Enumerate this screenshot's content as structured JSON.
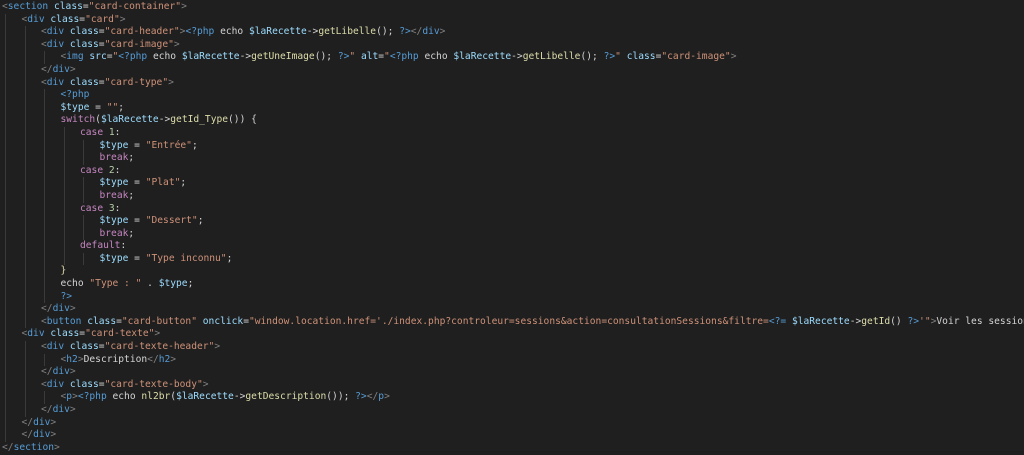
{
  "colors": {
    "background": "#1f1f1f",
    "punctuation": "#808080",
    "tag": "#569cd6",
    "attribute": "#9cdcfe",
    "string": "#ce9178",
    "variable": "#9cdcfe",
    "function": "#dcdcaa",
    "keyword": "#c586c0",
    "number": "#b5cea8",
    "text": "#d4d4d4",
    "phpTag": "#569cd6"
  },
  "lines": [
    {
      "indent": 0,
      "tokens": [
        [
          "p",
          "<"
        ],
        [
          "tag",
          "section"
        ],
        [
          "text",
          " "
        ],
        [
          "attribute",
          "class"
        ],
        [
          "text",
          "="
        ],
        [
          "string",
          "\"card-container\""
        ],
        [
          "p",
          ">"
        ]
      ]
    },
    {
      "indent": 1,
      "tokens": [
        [
          "p",
          "<"
        ],
        [
          "tag",
          "div"
        ],
        [
          "text",
          " "
        ],
        [
          "attribute",
          "class"
        ],
        [
          "text",
          "="
        ],
        [
          "string",
          "\"card\""
        ],
        [
          "p",
          ">"
        ]
      ]
    },
    {
      "indent": 2,
      "tokens": [
        [
          "p",
          "<"
        ],
        [
          "tag",
          "div"
        ],
        [
          "text",
          " "
        ],
        [
          "attribute",
          "class"
        ],
        [
          "text",
          "="
        ],
        [
          "string",
          "\"card-header\""
        ],
        [
          "p",
          ">"
        ],
        [
          "phpTag",
          "<?php"
        ],
        [
          "text",
          " echo "
        ],
        [
          "variable",
          "$laRecette"
        ],
        [
          "text",
          "->"
        ],
        [
          "function",
          "getLibelle"
        ],
        [
          "text",
          "(); "
        ],
        [
          "phpTag",
          "?>"
        ],
        [
          "p",
          "</"
        ],
        [
          "tag",
          "div"
        ],
        [
          "p",
          ">"
        ]
      ]
    },
    {
      "indent": 2,
      "tokens": [
        [
          "p",
          "<"
        ],
        [
          "tag",
          "div"
        ],
        [
          "text",
          " "
        ],
        [
          "attribute",
          "class"
        ],
        [
          "text",
          "="
        ],
        [
          "string",
          "\"card-image\""
        ],
        [
          "p",
          ">"
        ]
      ]
    },
    {
      "indent": 3,
      "tokens": [
        [
          "p",
          "<"
        ],
        [
          "tag",
          "img"
        ],
        [
          "text",
          " "
        ],
        [
          "attribute",
          "src"
        ],
        [
          "text",
          "="
        ],
        [
          "string",
          "\""
        ],
        [
          "phpTag",
          "<?php"
        ],
        [
          "text",
          " echo "
        ],
        [
          "variable",
          "$laRecette"
        ],
        [
          "text",
          "->"
        ],
        [
          "function",
          "getUneImage"
        ],
        [
          "text",
          "(); "
        ],
        [
          "phpTag",
          "?>"
        ],
        [
          "string",
          "\""
        ],
        [
          "text",
          " "
        ],
        [
          "attribute",
          "alt"
        ],
        [
          "text",
          "="
        ],
        [
          "string",
          "\""
        ],
        [
          "phpTag",
          "<?php"
        ],
        [
          "text",
          " echo "
        ],
        [
          "variable",
          "$laRecette"
        ],
        [
          "text",
          "->"
        ],
        [
          "function",
          "getLibelle"
        ],
        [
          "text",
          "(); "
        ],
        [
          "phpTag",
          "?>"
        ],
        [
          "string",
          "\""
        ],
        [
          "text",
          " "
        ],
        [
          "attribute",
          "class"
        ],
        [
          "text",
          "="
        ],
        [
          "string",
          "\"card-image\""
        ],
        [
          "p",
          ">"
        ]
      ]
    },
    {
      "indent": 2,
      "tokens": [
        [
          "p",
          "</"
        ],
        [
          "tag",
          "div"
        ],
        [
          "p",
          ">"
        ]
      ]
    },
    {
      "indent": 2,
      "tokens": [
        [
          "p",
          "<"
        ],
        [
          "tag",
          "div"
        ],
        [
          "text",
          " "
        ],
        [
          "attribute",
          "class"
        ],
        [
          "text",
          "="
        ],
        [
          "string",
          "\"card-type\""
        ],
        [
          "p",
          ">"
        ]
      ]
    },
    {
      "indent": 3,
      "tokens": [
        [
          "phpTag",
          "<?php"
        ]
      ]
    },
    {
      "indent": 3,
      "tokens": [
        [
          "variable",
          "$type"
        ],
        [
          "text",
          " = "
        ],
        [
          "string",
          "\"\""
        ],
        [
          "text",
          ";"
        ]
      ]
    },
    {
      "indent": 3,
      "tokens": [
        [
          "keyword",
          "switch"
        ],
        [
          "text",
          "("
        ],
        [
          "variable",
          "$laRecette"
        ],
        [
          "text",
          "->"
        ],
        [
          "function",
          "getId_Type"
        ],
        [
          "text",
          "()) {"
        ]
      ]
    },
    {
      "indent": 4,
      "tokens": [
        [
          "keyword",
          "case"
        ],
        [
          "text",
          " "
        ],
        [
          "number",
          "1"
        ],
        [
          "text",
          ":"
        ]
      ]
    },
    {
      "indent": 5,
      "tokens": [
        [
          "variable",
          "$type"
        ],
        [
          "text",
          " = "
        ],
        [
          "string",
          "\"Entrée\""
        ],
        [
          "text",
          ";"
        ]
      ]
    },
    {
      "indent": 5,
      "tokens": [
        [
          "keyword",
          "break"
        ],
        [
          "text",
          ";"
        ]
      ]
    },
    {
      "indent": 4,
      "tokens": [
        [
          "keyword",
          "case"
        ],
        [
          "text",
          " "
        ],
        [
          "number",
          "2"
        ],
        [
          "text",
          ":"
        ]
      ]
    },
    {
      "indent": 5,
      "tokens": [
        [
          "variable",
          "$type"
        ],
        [
          "text",
          " = "
        ],
        [
          "string",
          "\"Plat\""
        ],
        [
          "text",
          ";"
        ]
      ]
    },
    {
      "indent": 5,
      "tokens": [
        [
          "keyword",
          "break"
        ],
        [
          "text",
          ";"
        ]
      ]
    },
    {
      "indent": 4,
      "tokens": [
        [
          "keyword",
          "case"
        ],
        [
          "text",
          " "
        ],
        [
          "number",
          "3"
        ],
        [
          "text",
          ":"
        ]
      ]
    },
    {
      "indent": 5,
      "tokens": [
        [
          "variable",
          "$type"
        ],
        [
          "text",
          " = "
        ],
        [
          "string",
          "\"Dessert\""
        ],
        [
          "text",
          ";"
        ]
      ]
    },
    {
      "indent": 5,
      "tokens": [
        [
          "keyword",
          "break"
        ],
        [
          "text",
          ";"
        ]
      ]
    },
    {
      "indent": 4,
      "tokens": [
        [
          "keyword",
          "default"
        ],
        [
          "text",
          ":"
        ]
      ]
    },
    {
      "indent": 5,
      "tokens": [
        [
          "variable",
          "$type"
        ],
        [
          "text",
          " = "
        ],
        [
          "string",
          "\"Type inconnu\""
        ],
        [
          "text",
          ";"
        ]
      ]
    },
    {
      "indent": 3,
      "tokens": [
        [
          "function",
          "}"
        ]
      ]
    },
    {
      "indent": 3,
      "tokens": [
        [
          "text",
          "echo "
        ],
        [
          "string",
          "\"Type : \""
        ],
        [
          "text",
          " . "
        ],
        [
          "variable",
          "$type"
        ],
        [
          "text",
          ";"
        ]
      ]
    },
    {
      "indent": 3,
      "tokens": [
        [
          "phpTag",
          "?>"
        ]
      ]
    },
    {
      "indent": 2,
      "tokens": [
        [
          "p",
          "</"
        ],
        [
          "tag",
          "div"
        ],
        [
          "p",
          ">"
        ]
      ]
    },
    {
      "indent": 2,
      "tokens": [
        [
          "p",
          "<"
        ],
        [
          "tag",
          "button"
        ],
        [
          "text",
          " "
        ],
        [
          "attribute",
          "class"
        ],
        [
          "text",
          "="
        ],
        [
          "string",
          "\"card-button\""
        ],
        [
          "text",
          " "
        ],
        [
          "attribute",
          "onclick"
        ],
        [
          "text",
          "="
        ],
        [
          "string",
          "\"window.location.href='./index.php?controleur=sessions&action=consultationSessions&filtre="
        ],
        [
          "phpTag",
          "<?="
        ],
        [
          "text",
          " "
        ],
        [
          "variable",
          "$laRecette"
        ],
        [
          "text",
          "->"
        ],
        [
          "function",
          "getId"
        ],
        [
          "text",
          "() "
        ],
        [
          "phpTag",
          "?>"
        ],
        [
          "string",
          "'\""
        ],
        [
          "p",
          ">"
        ],
        [
          "text",
          "Voir les sessions associées"
        ],
        [
          "p",
          "</"
        ],
        [
          "tag",
          "button"
        ],
        [
          "p",
          ">"
        ]
      ]
    },
    {
      "indent": 1,
      "tokens": [
        [
          "p",
          "<"
        ],
        [
          "tag",
          "div"
        ],
        [
          "text",
          " "
        ],
        [
          "attribute",
          "class"
        ],
        [
          "text",
          "="
        ],
        [
          "string",
          "\"card-texte\""
        ],
        [
          "p",
          ">"
        ]
      ]
    },
    {
      "indent": 2,
      "tokens": [
        [
          "p",
          "<"
        ],
        [
          "tag",
          "div"
        ],
        [
          "text",
          " "
        ],
        [
          "attribute",
          "class"
        ],
        [
          "text",
          "="
        ],
        [
          "string",
          "\"card-texte-header\""
        ],
        [
          "p",
          ">"
        ]
      ]
    },
    {
      "indent": 3,
      "tokens": [
        [
          "p",
          "<"
        ],
        [
          "tag",
          "h2"
        ],
        [
          "p",
          ">"
        ],
        [
          "text",
          "Description"
        ],
        [
          "p",
          "</"
        ],
        [
          "tag",
          "h2"
        ],
        [
          "p",
          ">"
        ]
      ]
    },
    {
      "indent": 2,
      "tokens": [
        [
          "p",
          "</"
        ],
        [
          "tag",
          "div"
        ],
        [
          "p",
          ">"
        ]
      ]
    },
    {
      "indent": 2,
      "tokens": [
        [
          "p",
          "<"
        ],
        [
          "tag",
          "div"
        ],
        [
          "text",
          " "
        ],
        [
          "attribute",
          "class"
        ],
        [
          "text",
          "="
        ],
        [
          "string",
          "\"card-texte-body\""
        ],
        [
          "p",
          ">"
        ]
      ]
    },
    {
      "indent": 3,
      "tokens": [
        [
          "p",
          "<"
        ],
        [
          "tag",
          "p"
        ],
        [
          "p",
          ">"
        ],
        [
          "phpTag",
          "<?php"
        ],
        [
          "text",
          " echo "
        ],
        [
          "function",
          "nl2br"
        ],
        [
          "text",
          "("
        ],
        [
          "variable",
          "$laRecette"
        ],
        [
          "text",
          "->"
        ],
        [
          "function",
          "getDescription"
        ],
        [
          "text",
          "()); "
        ],
        [
          "phpTag",
          "?>"
        ],
        [
          "p",
          "</"
        ],
        [
          "tag",
          "p"
        ],
        [
          "p",
          ">"
        ]
      ]
    },
    {
      "indent": 2,
      "tokens": [
        [
          "p",
          "</"
        ],
        [
          "tag",
          "div"
        ],
        [
          "p",
          ">"
        ]
      ]
    },
    {
      "indent": 1,
      "tokens": [
        [
          "p",
          "</"
        ],
        [
          "tag",
          "div"
        ],
        [
          "p",
          ">"
        ]
      ]
    },
    {
      "indent": 1,
      "tokens": [
        [
          "p",
          "</"
        ],
        [
          "tag",
          "div"
        ],
        [
          "p",
          ">"
        ]
      ]
    },
    {
      "indent": 0,
      "tokens": [
        [
          "p",
          "</"
        ],
        [
          "tag",
          "section"
        ],
        [
          "p",
          ">"
        ]
      ]
    }
  ]
}
